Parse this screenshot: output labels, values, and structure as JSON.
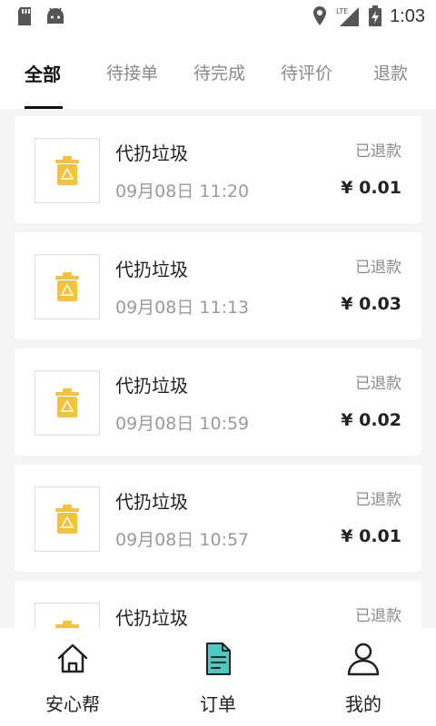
{
  "status_bar": {
    "time": "1:03",
    "network": "LTE"
  },
  "tabs": [
    {
      "label": "全部",
      "active": true
    },
    {
      "label": "待接单"
    },
    {
      "label": "待完成"
    },
    {
      "label": "待评价"
    },
    {
      "label": "退款"
    }
  ],
  "orders": [
    {
      "title": "代扔垃圾",
      "time": "09月08日 11:20",
      "status": "已退款",
      "price": "¥ 0.01"
    },
    {
      "title": "代扔垃圾",
      "time": "09月08日 11:13",
      "status": "已退款",
      "price": "¥ 0.03"
    },
    {
      "title": "代扔垃圾",
      "time": "09月08日 10:59",
      "status": "已退款",
      "price": "¥ 0.02"
    },
    {
      "title": "代扔垃圾",
      "time": "09月08日 10:57",
      "status": "已退款",
      "price": "¥ 0.01"
    },
    {
      "title": "代扔垃圾",
      "time": "",
      "status": "已退款",
      "price": ""
    }
  ],
  "bottom_nav": [
    {
      "label": "安心帮",
      "icon": "home-icon"
    },
    {
      "label": "订单",
      "icon": "document-icon",
      "active": true
    },
    {
      "label": "我的",
      "icon": "user-icon"
    }
  ],
  "colors": {
    "accent": "#f5c33b",
    "nav_active": "#48cbc3"
  }
}
